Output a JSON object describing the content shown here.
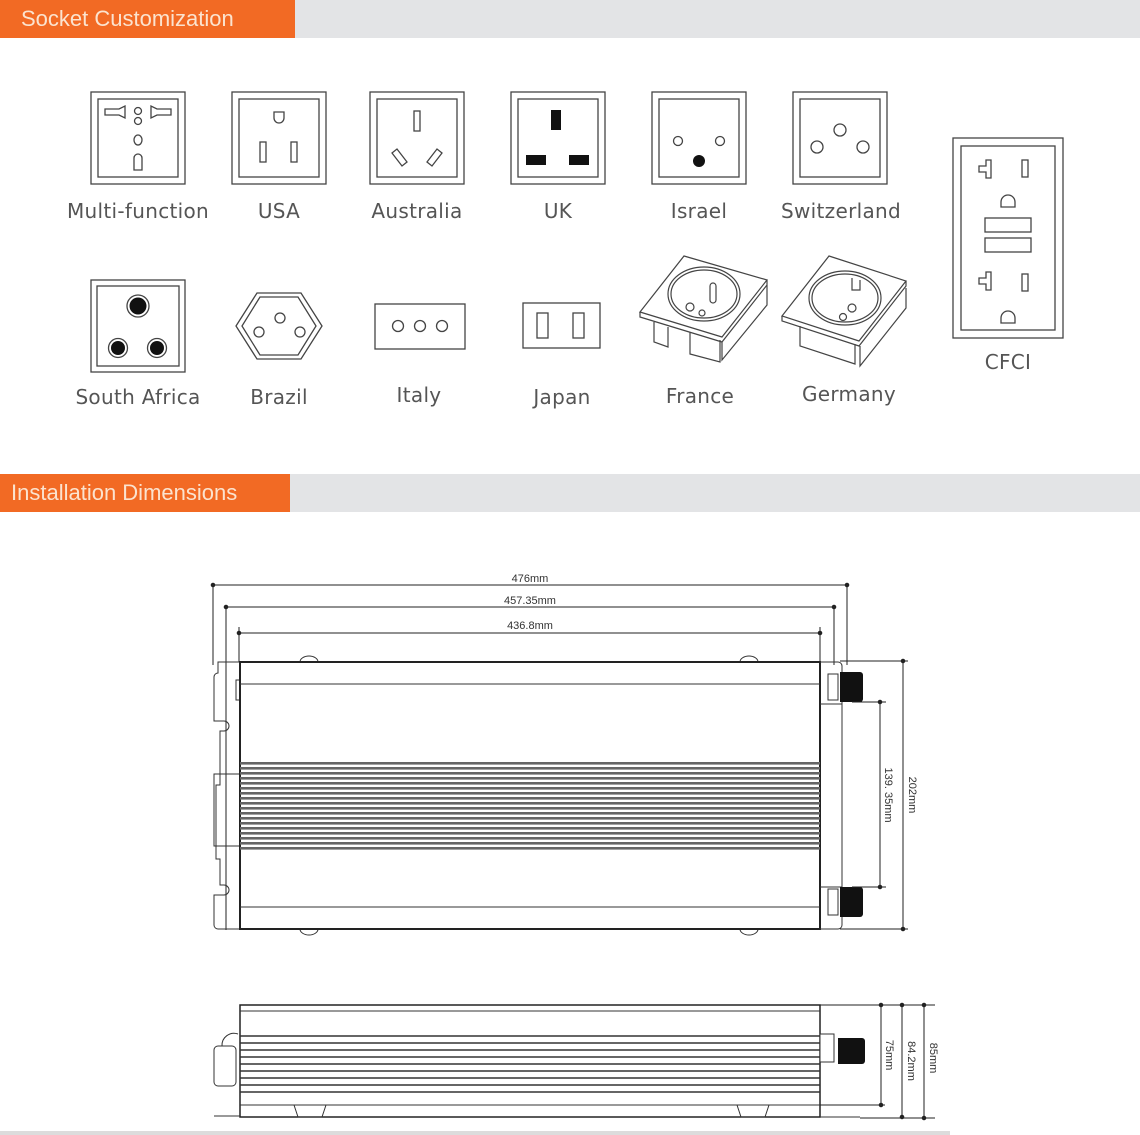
{
  "sections": {
    "socket": {
      "title": "Socket Customization"
    },
    "install": {
      "title": "Installation Dimensions"
    }
  },
  "sockets": [
    {
      "label": "Multi-function",
      "icon": "multi-function-socket-icon"
    },
    {
      "label": "USA",
      "icon": "usa-socket-icon"
    },
    {
      "label": "Australia",
      "icon": "australia-socket-icon"
    },
    {
      "label": "UK",
      "icon": "uk-socket-icon"
    },
    {
      "label": "Israel",
      "icon": "israel-socket-icon"
    },
    {
      "label": "Switzerland",
      "icon": "switzerland-socket-icon"
    },
    {
      "label": "CFCI",
      "icon": "cfci-socket-icon"
    },
    {
      "label": "South Africa",
      "icon": "south-africa-socket-icon"
    },
    {
      "label": "Brazil",
      "icon": "brazil-socket-icon"
    },
    {
      "label": "Italy",
      "icon": "italy-socket-icon"
    },
    {
      "label": "Japan",
      "icon": "japan-socket-icon"
    },
    {
      "label": "France",
      "icon": "france-socket-icon"
    },
    {
      "label": "Germany",
      "icon": "germany-socket-icon"
    }
  ],
  "dimensions": {
    "top_view": {
      "overall_length": "476mm",
      "mount_length": "457.35mm",
      "body_length": "436.8mm",
      "overall_width": "202mm",
      "terminal_spacing": "139. 35mm"
    },
    "side_view": {
      "overall_height": "85mm",
      "case_height": "84.2mm",
      "body_height": "75mm"
    }
  }
}
